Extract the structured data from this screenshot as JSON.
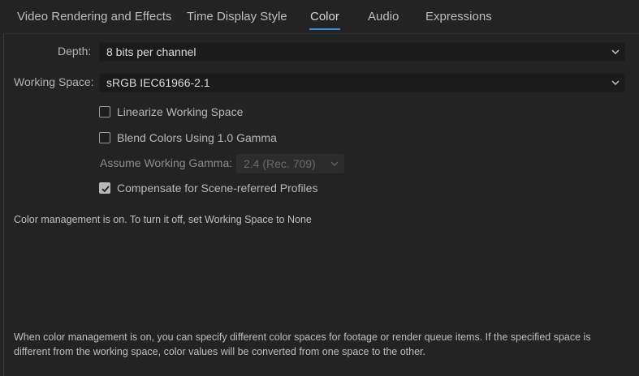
{
  "tabs": [
    {
      "label": "Video Rendering and Effects"
    },
    {
      "label": "Time Display Style"
    },
    {
      "label": "Color"
    },
    {
      "label": "Audio"
    },
    {
      "label": "Expressions"
    }
  ],
  "active_tab": "Color",
  "depth": {
    "label": "Depth:",
    "value": "8 bits per channel"
  },
  "working_space": {
    "label": "Working Space:",
    "value": "sRGB IEC61966-2.1"
  },
  "linearize": {
    "label": "Linearize Working Space",
    "checked": false
  },
  "blend": {
    "label": "Blend Colors Using 1.0 Gamma",
    "checked": false
  },
  "assume_gamma": {
    "label": "Assume Working Gamma:",
    "value": "2.4 (Rec. 709)",
    "disabled": true
  },
  "compensate": {
    "label": "Compensate for Scene-referred Profiles",
    "checked": true
  },
  "status_note": "Color management is on. To turn it off, set Working Space to None",
  "info_text": {
    "line1": "When color management is on, you can specify different color spaces for footage or render queue items. If the specified space is",
    "line2": "different from the working space, color values will be converted from one space to the other."
  },
  "colors": {
    "background": "#232323",
    "accent": "#3d8fd6",
    "field": "#1b1b1b"
  },
  "icons": {
    "dropdown": "chevron-down-icon",
    "check": "checkmark-icon"
  }
}
